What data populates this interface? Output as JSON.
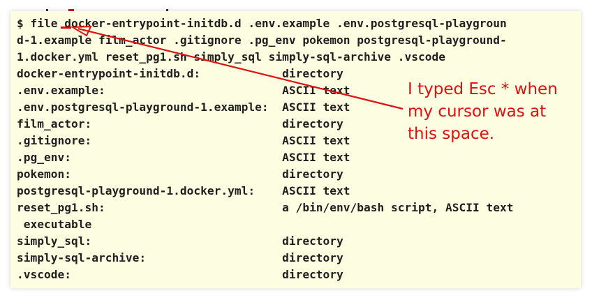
{
  "terminal": {
    "lines": [
      "$ file docker-entrypoint-initdb.d .env.example .env.postgresql-playgroun",
      "d-1.example film_actor .gitignore .pg_env pokemon postgresql-playground-",
      "1.docker.yml reset_pg1.sh simply_sql simply-sql-archive .vscode",
      "docker-entrypoint-initdb.d:            directory",
      ".env.example:                          ASCII text",
      ".env.postgresql-playground-1.example:  ASCII text",
      "film_actor:                            directory",
      ".gitignore:                            ASCII text",
      ".pg_env:                               ASCII text",
      "pokemon:                               directory",
      "postgresql-playground-1.docker.yml:    ASCII text",
      "reset_pg1.sh:                          a /bin/env/bash script, ASCII text",
      " executable",
      "simply_sql:                            directory",
      "simply-sql-archive:                    directory",
      ".vscode:                               directory"
    ]
  },
  "annotation": {
    "lines": [
      "I typed Esc * when",
      "my cursor was at",
      "this space."
    ],
    "color": "#e01010"
  },
  "colors": {
    "terminal_bg": "#fdfde1",
    "text": "#1f1f1f",
    "accent": "#e00000"
  }
}
